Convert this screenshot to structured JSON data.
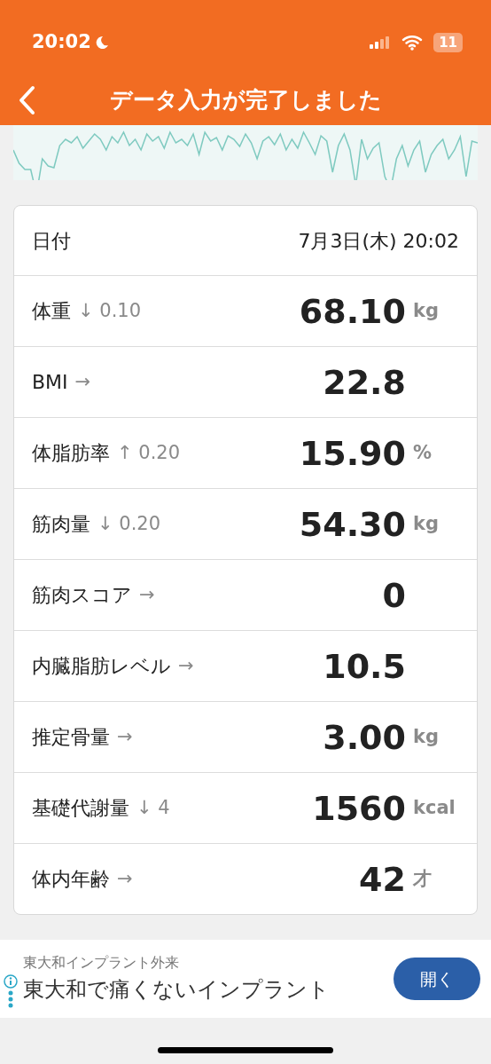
{
  "status_bar": {
    "time": "20:02",
    "battery": "11"
  },
  "nav": {
    "title": "データ入力が完了しました"
  },
  "date_row": {
    "label": "日付",
    "value": "7月3日(木) 20:02"
  },
  "metrics": [
    {
      "label": "体重",
      "trend": "↓ 0.10",
      "value": "68.10",
      "unit": "kg"
    },
    {
      "label": "BMI",
      "trend": "→",
      "value": "22.8"
    },
    {
      "label": "体脂肪率",
      "trend": "↑ 0.20",
      "value": "15.90",
      "unit": "%"
    },
    {
      "label": "筋肉量",
      "trend": "↓ 0.20",
      "value": "54.30",
      "unit": "kg"
    },
    {
      "label": "筋肉スコア",
      "trend": "→",
      "value": "0"
    },
    {
      "label": "内臓脂肪レベル",
      "trend": "→",
      "value": "10.5"
    },
    {
      "label": "推定骨量",
      "trend": "→",
      "value": "3.00",
      "unit": "kg"
    },
    {
      "label": "基礎代謝量",
      "trend": "↓ 4",
      "value": "1560",
      "unit": "kcal"
    },
    {
      "label": "体内年齢",
      "trend": "→",
      "value": "42",
      "unit": "才"
    }
  ],
  "ad": {
    "advertiser": "東大和インプラント外来",
    "headline": "東大和で痛くないインプラント",
    "button": "開く"
  }
}
